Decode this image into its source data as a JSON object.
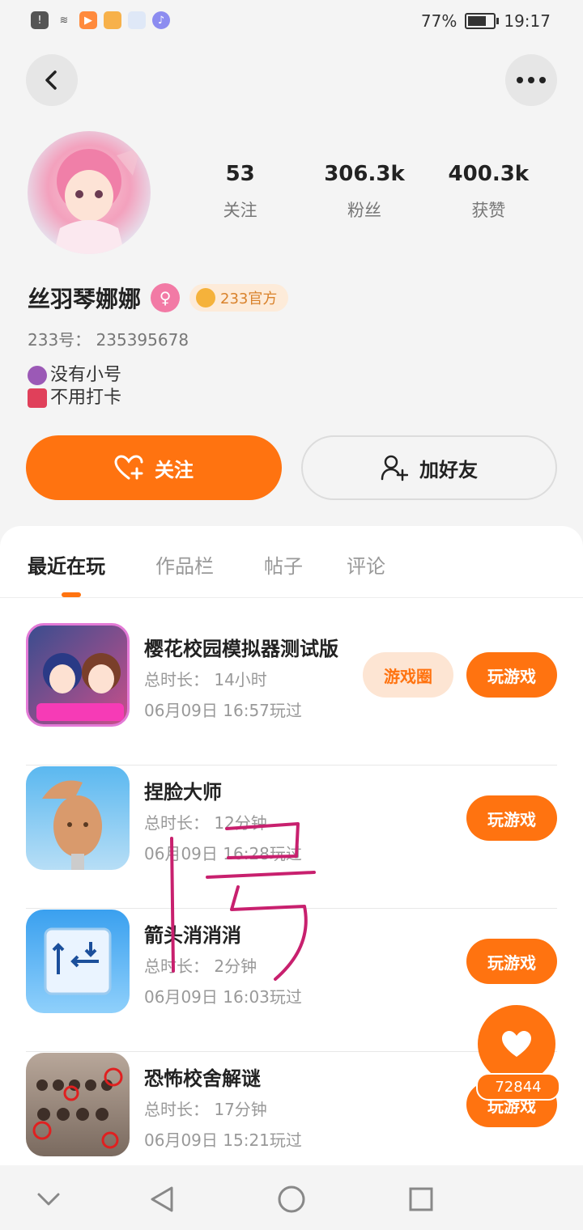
{
  "status_bar": {
    "battery": "77%",
    "time": "19:17"
  },
  "header": {
    "back_icon": "chevron-left-icon",
    "more_icon": "more-dots-icon"
  },
  "profile": {
    "stats": [
      {
        "value": "53",
        "label": "关注"
      },
      {
        "value": "306.3k",
        "label": "粉丝"
      },
      {
        "value": "400.3k",
        "label": "获赞"
      }
    ],
    "name": "丝羽琴娜娜",
    "gender_icon": "female-icon",
    "official_badge": "233官方",
    "uid": "233号：  235395678",
    "bio": [
      "没有小号",
      "不用打卡"
    ]
  },
  "actions": {
    "follow_label": "关注",
    "add_friend_label": "加好友"
  },
  "tabs": [
    "最近在玩",
    "作品栏",
    "帖子",
    "评论"
  ],
  "games": [
    {
      "title": "樱花校园模拟器测试版",
      "duration": "总时长：  14小时",
      "last_played": "06月09日  16:57玩过",
      "circle_label": "游戏圈",
      "play_label": "玩游戏"
    },
    {
      "title": "捏脸大师",
      "duration": "总时长：  12分钟",
      "last_played": "06月09日  16:28玩过",
      "play_label": "玩游戏"
    },
    {
      "title": "箭头消消消",
      "duration": "总时长：  2分钟",
      "last_played": "06月09日  16:03玩过",
      "play_label": "玩游戏"
    },
    {
      "title": "恐怖校舍解谜",
      "duration": "总时长：  17分钟",
      "last_played": "06月09日  15:21玩过",
      "play_label": "玩游戏"
    }
  ],
  "like_fab": {
    "count": "72844",
    "icon": "heart-icon"
  },
  "nav": [
    "chevron-down-icon",
    "back-triangle-icon",
    "home-circle-icon",
    "recents-square-icon"
  ],
  "colors": {
    "accent": "#ff7310",
    "scribble": "#c8206e"
  }
}
